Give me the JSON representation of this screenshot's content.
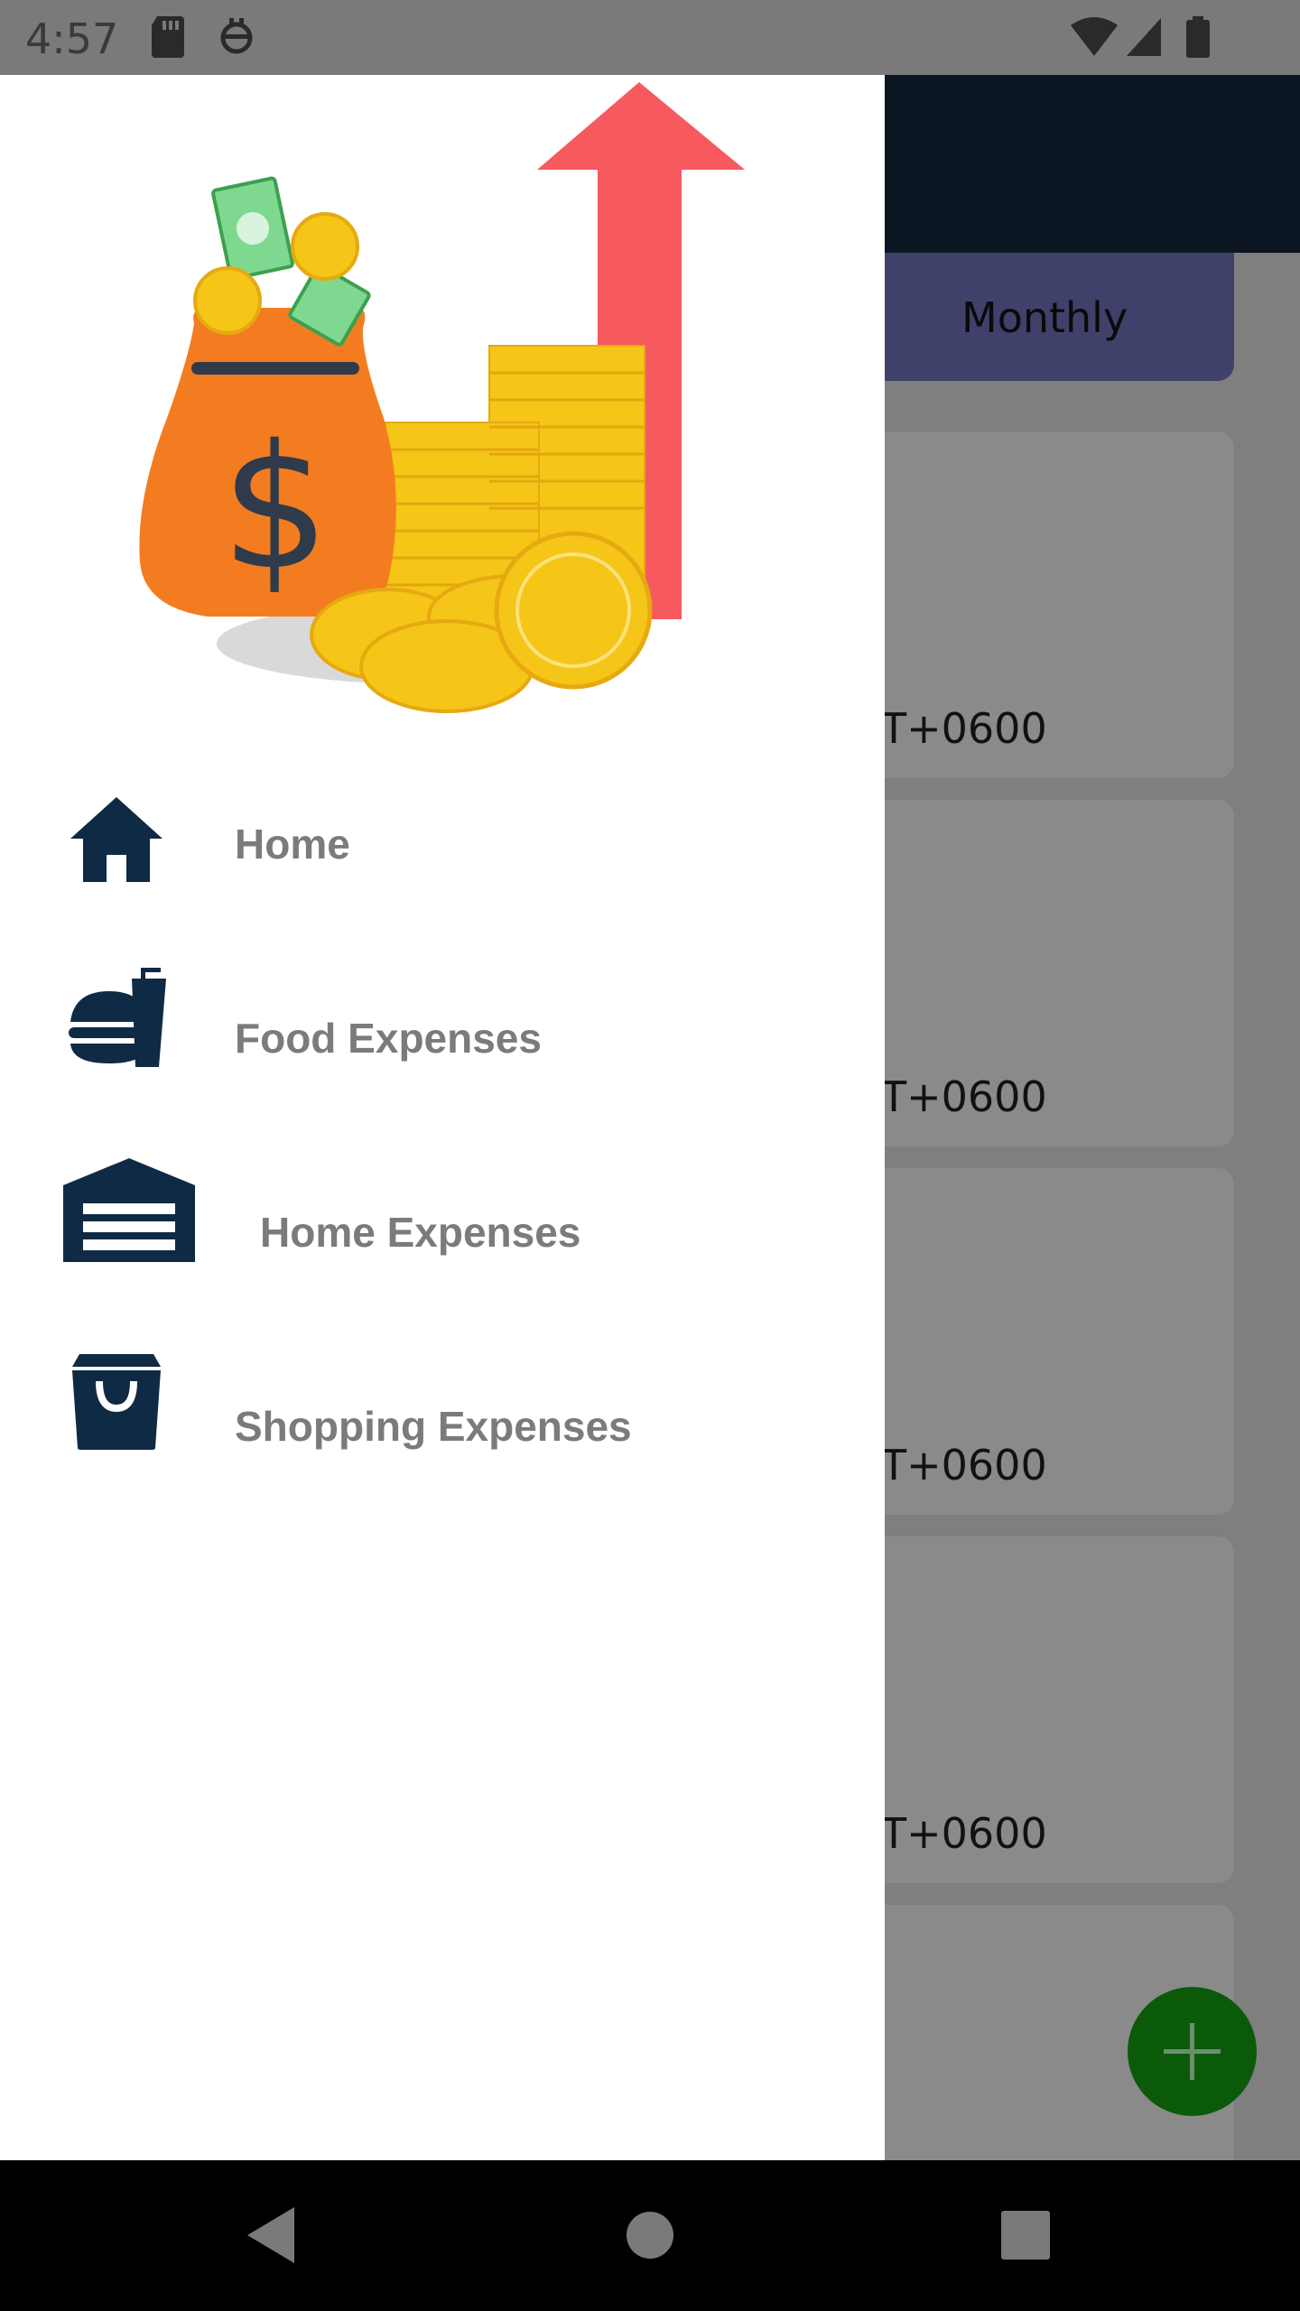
{
  "status_bar": {
    "time": "4:57"
  },
  "background_screen": {
    "tab_label": "Monthly",
    "card_texts": [
      "T+0600",
      "T+0600",
      "T+0600",
      "T+0600"
    ]
  },
  "drawer": {
    "items": [
      {
        "label": "Home",
        "icon": "home-icon"
      },
      {
        "label": "Food Expenses",
        "icon": "food-icon"
      },
      {
        "label": "Home Expenses",
        "icon": "garage-icon"
      },
      {
        "label": "Shopping Expenses",
        "icon": "shopping-bag-icon"
      }
    ]
  },
  "colors": {
    "icon": "#0f2a44",
    "label": "#7b7b7b",
    "accent_arrow": "#f65a5f",
    "fab": "#0a5a0a"
  }
}
